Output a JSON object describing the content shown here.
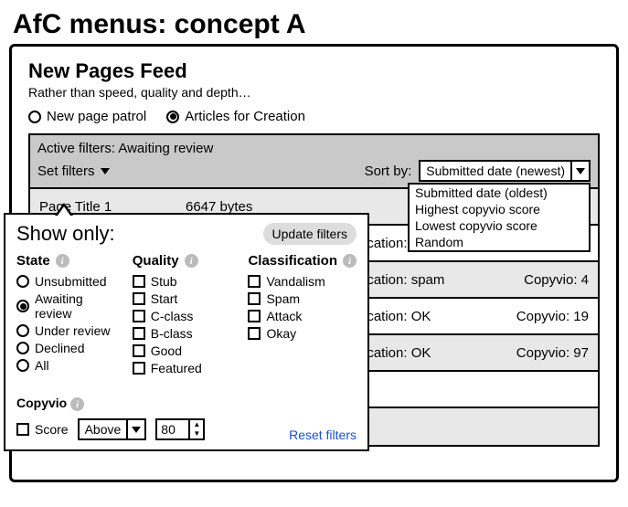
{
  "title": "AfC menus: concept A",
  "header": {
    "heading": "New Pages Feed",
    "subheading": "Rather than speed, quality and depth…",
    "views": {
      "patrol": "New page patrol",
      "afc": "Articles for Creation"
    }
  },
  "filterbar": {
    "active_prefix": "Active filters: ",
    "active_value": "Awaiting review",
    "set_filters": "Set filters",
    "sort_label": "Sort by:",
    "sort_selected": "Submitted date (newest)",
    "sort_options": [
      "Submitted date (oldest)",
      "Highest copyvio score",
      "Lowest copyvio score",
      "Random"
    ]
  },
  "feed": [
    {
      "title": "Page Title 1",
      "bytes": "6647 bytes",
      "classification": "",
      "copyvio": ""
    },
    {
      "title": "",
      "bytes": "",
      "classification": "Classification: OK",
      "copyvio": ""
    },
    {
      "title": "",
      "bytes": "",
      "classification": "Classification: spam",
      "copyvio": "Copyvio: 4"
    },
    {
      "title": "",
      "bytes": "",
      "classification": "Classification: OK",
      "copyvio": "Copyvio: 19"
    },
    {
      "title": "",
      "bytes": "",
      "classification": "Classification: OK",
      "copyvio": "Copyvio: 97"
    },
    {
      "title": "",
      "bytes": "",
      "classification": "",
      "copyvio": ""
    },
    {
      "title": "",
      "bytes": "",
      "classification": "",
      "copyvio": ""
    }
  ],
  "popup": {
    "show_only": "Show only:",
    "update": "Update filters",
    "reset": "Reset filters",
    "sections": {
      "state": {
        "label": "State",
        "options": [
          "Unsubmitted",
          "Awaiting review",
          "Under review",
          "Declined",
          "All"
        ],
        "selected": "Awaiting review"
      },
      "quality": {
        "label": "Quality",
        "options": [
          "Stub",
          "Start",
          "C-class",
          "B-class",
          "Good",
          "Featured"
        ]
      },
      "classification": {
        "label": "Classification",
        "options": [
          "Vandalism",
          "Spam",
          "Attack",
          "Okay"
        ]
      },
      "copyvio": {
        "label": "Copyvio",
        "score_label": "Score",
        "direction": "Above",
        "value": "80"
      }
    }
  }
}
